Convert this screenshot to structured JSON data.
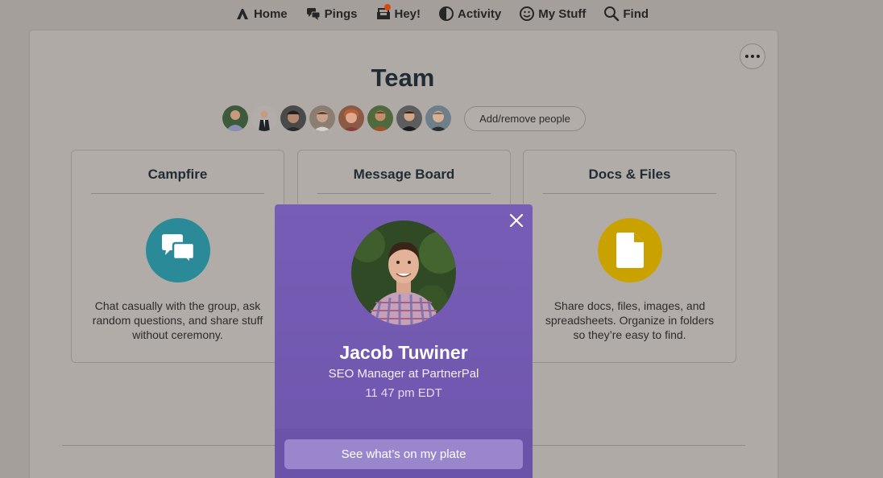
{
  "nav": {
    "items": [
      {
        "label": "Home",
        "icon": "home-icon"
      },
      {
        "label": "Pings",
        "icon": "pings-icon"
      },
      {
        "label": "Hey!",
        "icon": "hey-icon"
      },
      {
        "label": "Activity",
        "icon": "activity-icon"
      },
      {
        "label": "My Stuff",
        "icon": "my-stuff-icon"
      },
      {
        "label": "Find",
        "icon": "search-icon"
      }
    ],
    "notification_color": "#d9480f"
  },
  "project": {
    "title": "Team",
    "add_people_label": "Add/remove people",
    "people_count": 8
  },
  "tools": [
    {
      "title": "Campfire",
      "description": "Chat casually with the group, ask random questions, and share stuff without ceremony.",
      "icon": "chat-bubbles-icon",
      "color": "#2a8a98"
    },
    {
      "title": "Message Board",
      "description": "",
      "icon": "message-board-icon",
      "color": ""
    },
    {
      "title": "Docs & Files",
      "description": "Share docs, files, images, and spreadsheets. Organize in folders so they’re easy to find.",
      "icon": "document-icon",
      "color": "#c9a200"
    }
  ],
  "popup": {
    "name": "Jacob Tuwiner",
    "role": "SEO Manager at PartnerPal",
    "time": "11 47 pm EDT",
    "button_label": "See what’s on my plate",
    "background": "#735ab2"
  }
}
